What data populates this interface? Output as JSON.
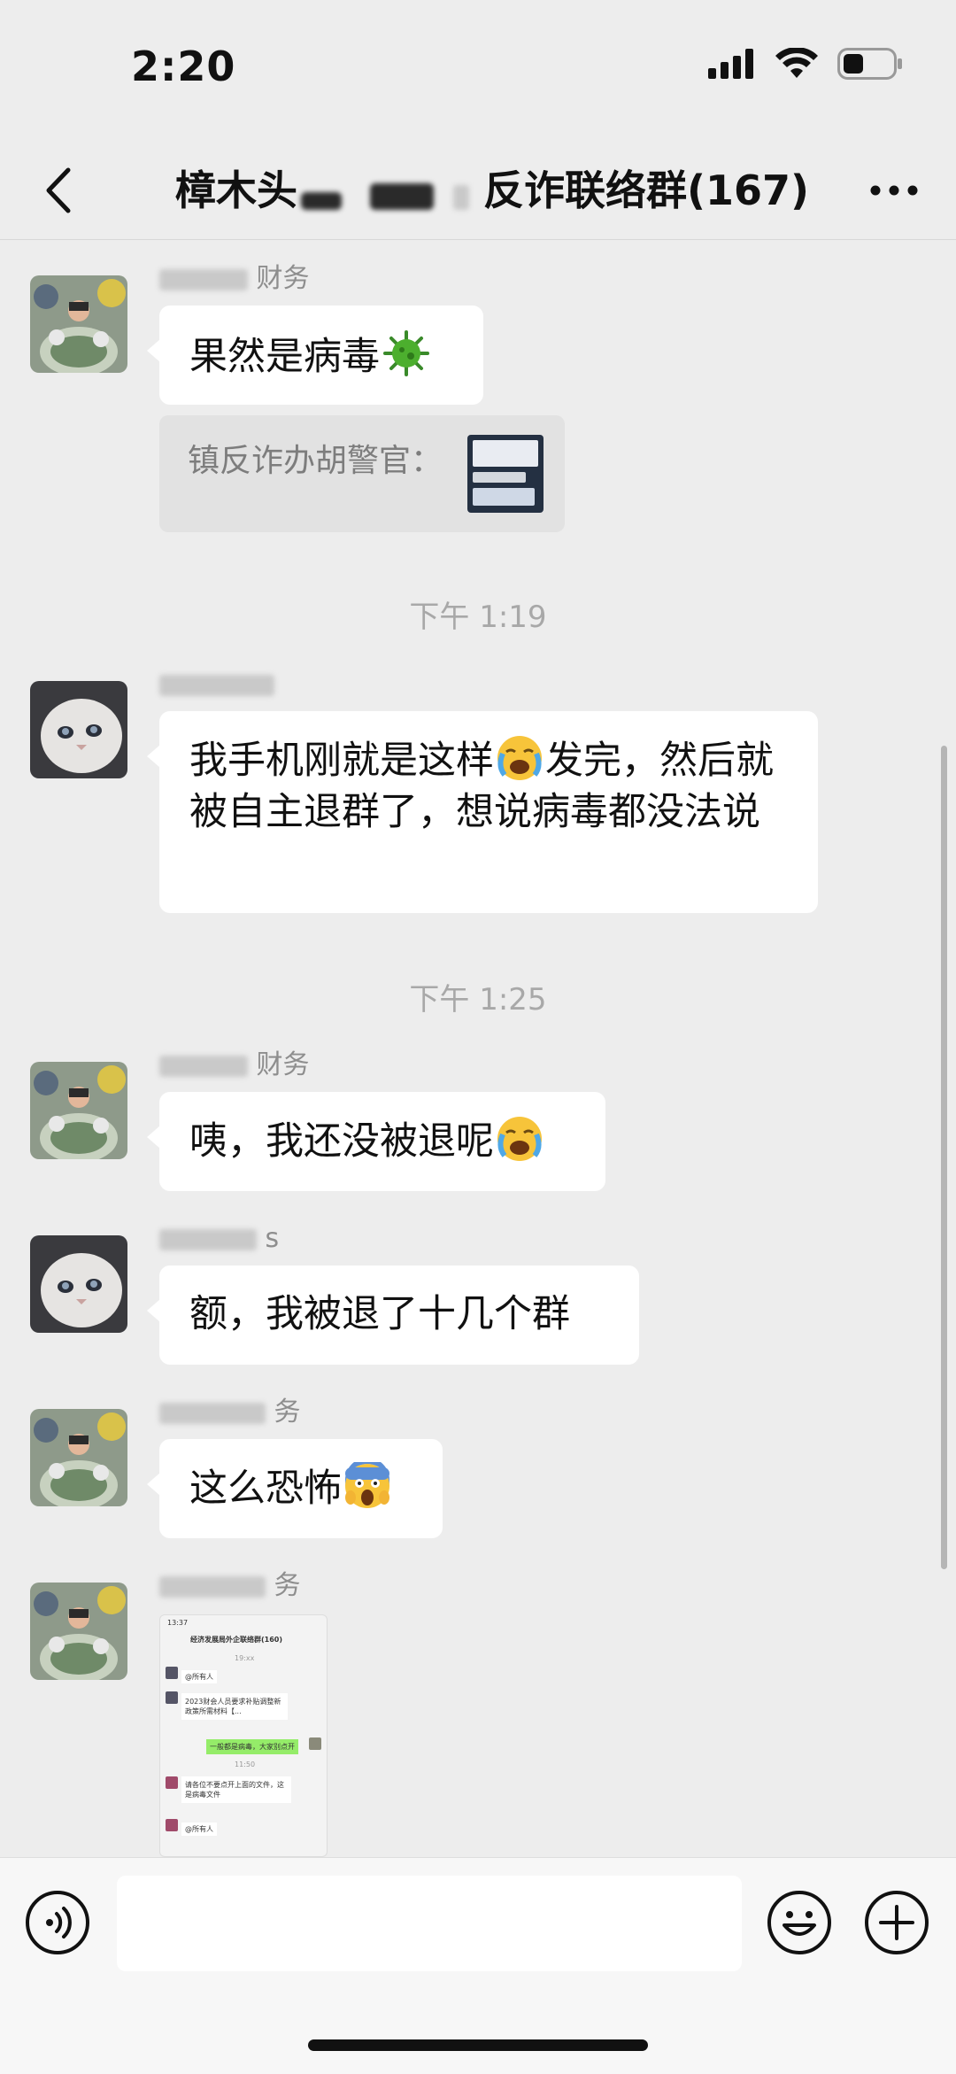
{
  "status_bar": {
    "time": "2:20",
    "battery_level": 0.4
  },
  "nav": {
    "title_start": "樟木头",
    "title_end": "反诈联络群(167)",
    "back_icon": "chevron-left-icon",
    "more_icon": "more-dots-icon"
  },
  "messages": [
    {
      "sender_suffix": "财务",
      "text": "果然是病毒",
      "emoji": "virus"
    },
    {
      "quote_text": "镇反诈办胡警官："
    },
    {
      "timestamp": "下午 1:19"
    },
    {
      "sender_suffix": "",
      "text": "我手机刚就是这样",
      "emoji": "loudly-crying",
      "text_after": "发完，然后就被自主退群了，想说病毒都没法说"
    },
    {
      "timestamp": "下午 1:25"
    },
    {
      "sender_suffix": "财务",
      "text": "咦，我还没被退呢",
      "emoji": "loudly-crying"
    },
    {
      "sender_suffix": "s",
      "text": "额，我被退了十几个群"
    },
    {
      "sender_suffix": "务",
      "text": "这么恐怖",
      "emoji": "screaming-in-fear"
    },
    {
      "sender_suffix": "务",
      "image": "chat-screenshot"
    }
  ],
  "shared_screenshot": {
    "time": "13:37",
    "title": "经济发展局外企联络群(160)",
    "lines": [
      "19:xx",
      "@所有人",
      "2023财会人员要求补贴调整新政策所需材料【...",
      "一般都是病毒，大家别点开",
      "11:50",
      "请各位不要点开上面的文件，这是病毒文件",
      "@所有人"
    ]
  },
  "input": {
    "placeholder": ""
  },
  "icons": {
    "voice": "voice-icon",
    "emoji": "emoji-icon",
    "plus": "plus-icon"
  },
  "colors": {
    "background": "#ededed",
    "bubble": "#ffffff",
    "quote": "#e2e2e2",
    "timestamp": "#a8a8a8",
    "sender": "#8e8e8e"
  }
}
